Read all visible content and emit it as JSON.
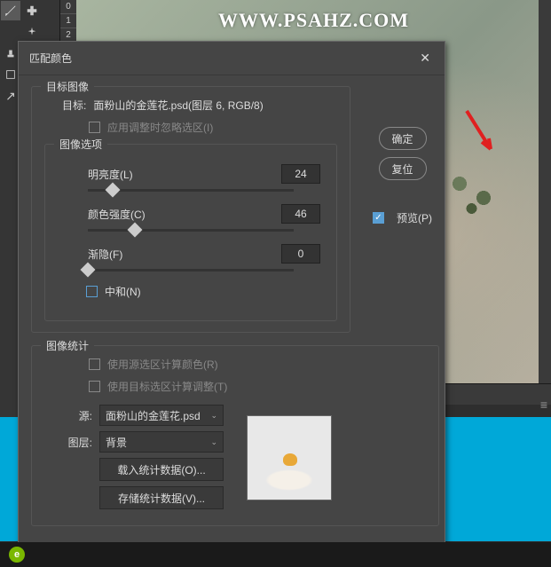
{
  "watermark": "WWW.PSAHZ.COM",
  "layers_numbers": [
    "0",
    "1",
    "2"
  ],
  "dialog": {
    "title": "匹配颜色",
    "target_group": "目标图像",
    "target_label": "目标:",
    "target_value": "面粉山的金莲花.psd(图层 6, RGB/8)",
    "ignore_selection": "应用调整时忽略选区(I)",
    "options_group": "图像选项",
    "brightness_label": "明亮度(L)",
    "brightness_value": "24",
    "intensity_label": "颜色强度(C)",
    "intensity_value": "46",
    "fade_label": "渐隐(F)",
    "fade_value": "0",
    "neutralize": "中和(N)",
    "stats_group": "图像统计",
    "use_source_selection": "使用源选区计算颜色(R)",
    "use_target_selection": "使用目标选区计算调整(T)",
    "source_label": "源:",
    "source_value": "面粉山的金莲花.psd",
    "layer_label": "图层:",
    "layer_value": "背景",
    "load_stats": "载入统计数据(O)...",
    "save_stats": "存储统计数据(V)...",
    "ok": "确定",
    "reset": "复位",
    "preview": "预览(P)"
  },
  "slider_positions": {
    "brightness": 12,
    "intensity": 23,
    "fade": 0
  }
}
